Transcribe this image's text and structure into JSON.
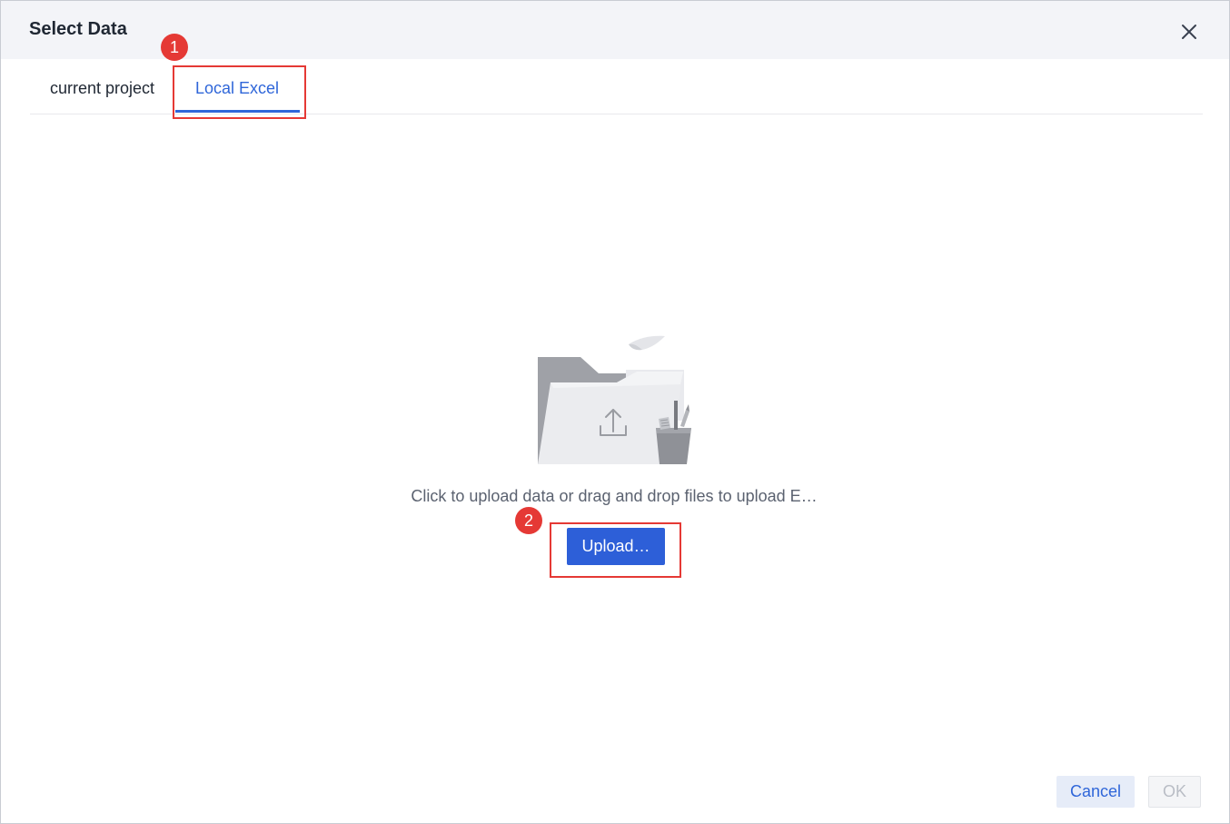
{
  "dialog": {
    "title": "Select Data",
    "close_icon": "close-icon"
  },
  "tabs": [
    {
      "label": "current project",
      "active": false
    },
    {
      "label": "Local Excel",
      "active": true
    }
  ],
  "upload_area": {
    "illustration_icon": "folder-upload-illustration",
    "hint": "Click to upload data or drag and drop files to upload E…",
    "upload_label": "Upload…"
  },
  "annotations": [
    {
      "number": "1",
      "target": "tab-local-excel"
    },
    {
      "number": "2",
      "target": "upload-button"
    }
  ],
  "footer": {
    "cancel_label": "Cancel",
    "ok_label": "OK",
    "ok_enabled": false
  },
  "colors": {
    "accent": "#2f66d9",
    "primary_button": "#2d5fd8",
    "annotation": "#e53935",
    "header_bg": "#f3f4f8"
  }
}
